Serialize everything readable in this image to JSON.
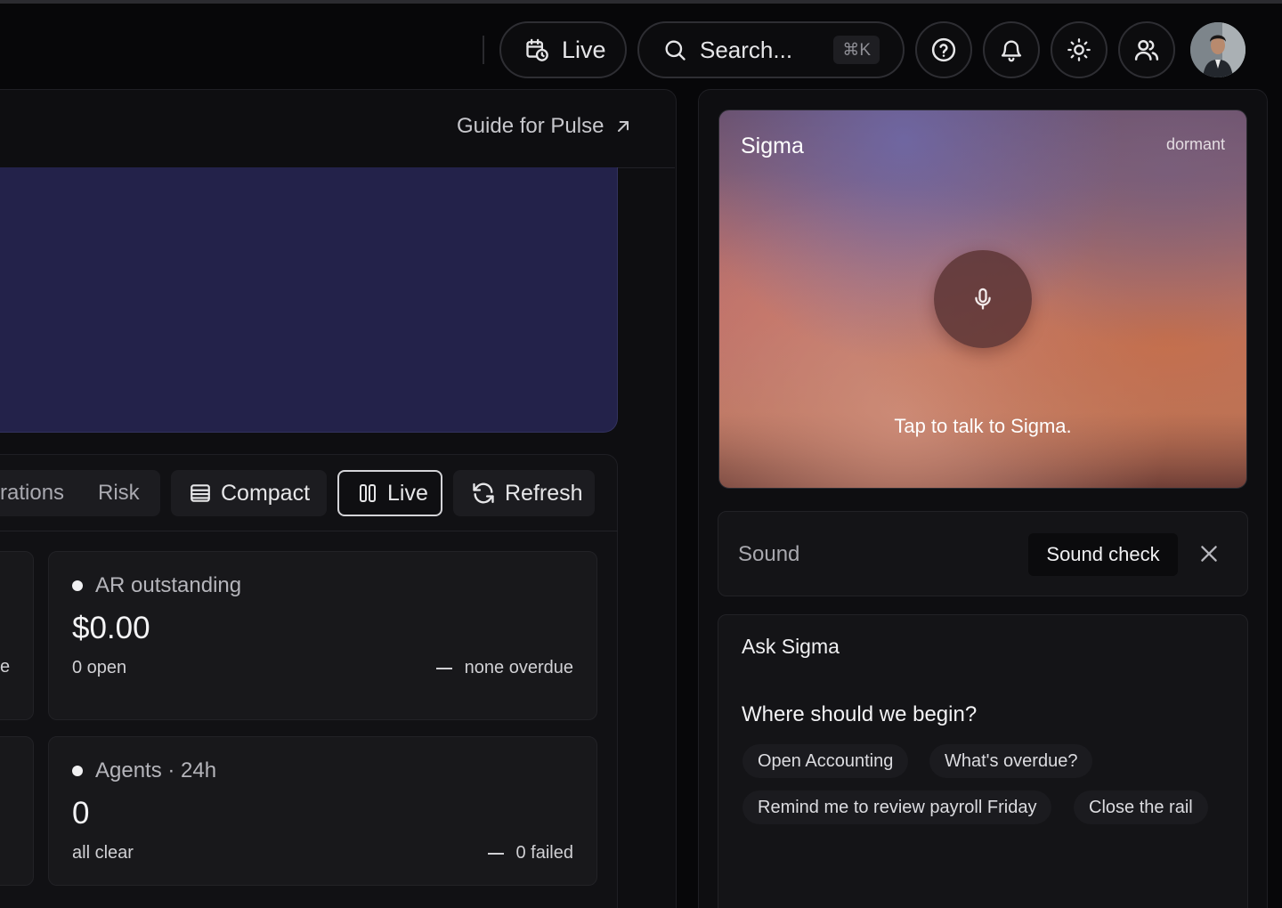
{
  "header": {
    "live_label": "Live",
    "search_placeholder": "Search...",
    "search_shortcut": "⌘K"
  },
  "main": {
    "guide_link": "Guide for Pulse",
    "toolbar": {
      "segment_items": [
        "rations",
        "Risk"
      ],
      "compact_label": "Compact",
      "live_label": "Live",
      "refresh_label": "Refresh"
    },
    "edge_text": "e",
    "cards": [
      {
        "title": "AR outstanding",
        "value": "$0.00",
        "sub": "0 open",
        "meta": "none overdue"
      },
      {
        "title": "Agents · 24h",
        "value": "0",
        "sub": "all clear",
        "meta": "0 failed"
      }
    ]
  },
  "rail": {
    "sigma": {
      "title": "Sigma",
      "status": "dormant",
      "hint": "Tap to talk to Sigma."
    },
    "sound": {
      "label": "Sound",
      "check_label": "Sound check"
    },
    "ask": {
      "title": "Ask Sigma",
      "question": "Where should we begin?",
      "chips": [
        "Open Accounting",
        "What's overdue?",
        "Remind me to review payroll Friday",
        "Close the rail"
      ]
    }
  },
  "colors": {
    "background": "#070709",
    "panel": "#0e0e11",
    "hero": "#23224a",
    "card": "#18181b",
    "active_border": "#d4d4d8"
  },
  "icons": [
    "calendar-clock-icon",
    "search-icon",
    "help-icon",
    "bell-icon",
    "sun-icon",
    "users-icon",
    "arrow-up-right-icon",
    "list-icon",
    "columns-icon",
    "refresh-icon",
    "mic-icon",
    "close-icon"
  ]
}
